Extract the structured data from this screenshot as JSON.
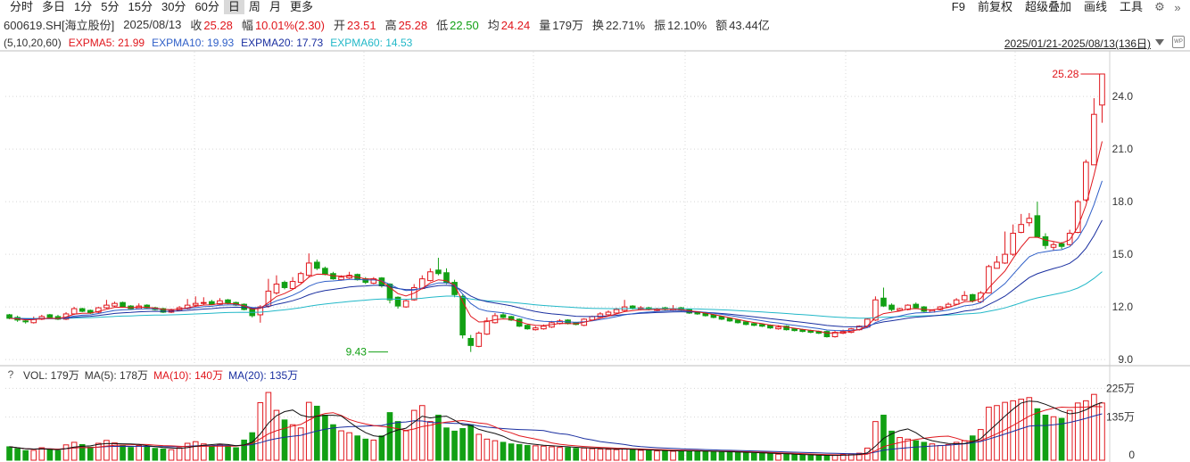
{
  "periods": [
    {
      "label": "分时",
      "active": false
    },
    {
      "label": "多日",
      "active": false
    },
    {
      "label": "1分",
      "active": false
    },
    {
      "label": "5分",
      "active": false
    },
    {
      "label": "15分",
      "active": false
    },
    {
      "label": "30分",
      "active": false
    },
    {
      "label": "60分",
      "active": false
    },
    {
      "label": "日",
      "active": true
    },
    {
      "label": "周",
      "active": false
    },
    {
      "label": "月",
      "active": false
    },
    {
      "label": "更多",
      "active": false
    }
  ],
  "tools": [
    "F9",
    "前复权",
    "超级叠加",
    "画线",
    "工具"
  ],
  "tool_icons": [
    "gear-icon",
    "double-chevron-right-icon"
  ],
  "quote": {
    "symbol": "600619.SH[海立股份]",
    "date": "2025/08/13",
    "fields": [
      {
        "key": "收",
        "value": "25.28",
        "tone": "red"
      },
      {
        "key": "幅",
        "value": "10.01%(2.30)",
        "tone": "red"
      },
      {
        "key": "开",
        "value": "23.51",
        "tone": "red"
      },
      {
        "key": "高",
        "value": "25.28",
        "tone": "red"
      },
      {
        "key": "低",
        "value": "22.50",
        "tone": "green"
      },
      {
        "key": "均",
        "value": "24.24",
        "tone": "red"
      },
      {
        "key": "量",
        "value": "179万",
        "tone": "plain"
      },
      {
        "key": "换",
        "value": "22.71%",
        "tone": "plain"
      },
      {
        "key": "振",
        "value": "12.10%",
        "tone": "plain"
      },
      {
        "key": "额",
        "value": "43.44亿",
        "tone": "plain"
      }
    ]
  },
  "ma_legend": [
    {
      "label": "(5,10,20,60)",
      "color": "#333333"
    },
    {
      "label": "EXPMA5: 21.99",
      "color": "#e0161c"
    },
    {
      "label": "EXPMA10: 19.93",
      "color": "#2f5fc8"
    },
    {
      "label": "EXPMA20: 17.73",
      "color": "#1a2fa0"
    },
    {
      "label": "EXPMA60: 14.53",
      "color": "#22b8c8"
    }
  ],
  "date_range": "2025/01/21-2025/08/13(136日)",
  "vol_legend": [
    {
      "label": "VOL: 179万",
      "color": "#333333"
    },
    {
      "label": "MA(5): 178万",
      "color": "#333333"
    },
    {
      "label": "MA(10): 140万",
      "color": "#e0161c"
    },
    {
      "label": "MA(20): 135万",
      "color": "#1a2fa0"
    }
  ],
  "chart_data": {
    "type": "candlestick",
    "x_range": [
      "2025/01/21",
      "2025/08/13"
    ],
    "count": 136,
    "price_axis": {
      "ticks": [
        9.0,
        12.0,
        15.0,
        18.0,
        21.0,
        24.0
      ],
      "ylim": [
        8.75,
        26.55
      ]
    },
    "volume_axis": {
      "ticks": [
        {
          "value": 0,
          "label": "0"
        },
        {
          "value": 135,
          "label": "135万"
        },
        {
          "value": 225,
          "label": "225万"
        }
      ],
      "ylim": [
        0,
        240
      ],
      "unit": "万"
    },
    "annotations": [
      {
        "label": "25.28",
        "value": 25.28,
        "kind": "high",
        "index": 135
      },
      {
        "label": "9.43",
        "value": 9.43,
        "kind": "low",
        "index": 47
      }
    ],
    "colors": {
      "up": "#e0161c",
      "down": "#12a014",
      "ema5": "#e0161c",
      "ema10": "#2f5fc8",
      "ema20": "#1a2fa0",
      "ema60": "#22b8c8",
      "vma5": "#111111",
      "vma10": "#e0161c",
      "vma20": "#1a2fa0"
    },
    "close": [
      11.35,
      11.25,
      11.15,
      11.3,
      11.45,
      11.4,
      11.3,
      11.6,
      11.9,
      11.75,
      11.65,
      11.95,
      12.1,
      12.2,
      12.0,
      11.9,
      12.05,
      11.95,
      11.85,
      11.7,
      11.8,
      11.95,
      12.1,
      12.2,
      12.25,
      12.15,
      12.35,
      12.2,
      12.1,
      11.85,
      11.5,
      12.0,
      12.9,
      13.3,
      13.1,
      13.45,
      13.9,
      14.5,
      14.2,
      13.85,
      13.6,
      13.7,
      13.8,
      13.55,
      13.4,
      13.6,
      13.2,
      12.4,
      12.05,
      12.35,
      13.1,
      13.6,
      14.0,
      13.9,
      13.4,
      12.7,
      10.4,
      9.8,
      10.5,
      11.2,
      11.5,
      11.4,
      11.25,
      10.9,
      10.75,
      10.8,
      10.9,
      11.1,
      11.2,
      11.05,
      11.0,
      11.3,
      11.45,
      11.6,
      11.7,
      11.85,
      12.0,
      11.9,
      11.95,
      11.85,
      11.9,
      11.85,
      11.9,
      11.8,
      11.65,
      11.6,
      11.5,
      11.4,
      11.3,
      11.2,
      11.1,
      11.0,
      10.95,
      10.9,
      10.8,
      10.85,
      10.7,
      10.65,
      10.6,
      10.55,
      10.5,
      10.3,
      10.55,
      10.6,
      10.75,
      10.9,
      11.3,
      12.4,
      12.05,
      11.85,
      11.9,
      12.1,
      11.95,
      11.75,
      11.8,
      12.0,
      12.15,
      12.4,
      12.65,
      12.35,
      12.8,
      14.3,
      14.55,
      15.0,
      16.2,
      16.7,
      17.05,
      16.0,
      15.5,
      15.55,
      15.45,
      16.2,
      18.0,
      20.25,
      22.98,
      25.28
    ],
    "open": [
      11.55,
      11.4,
      11.2,
      11.1,
      11.3,
      11.55,
      11.45,
      11.3,
      11.6,
      11.9,
      11.8,
      11.7,
      11.95,
      12.05,
      12.25,
      12.05,
      11.9,
      12.1,
      11.95,
      11.9,
      11.7,
      11.8,
      11.9,
      12.1,
      12.2,
      12.3,
      12.15,
      12.4,
      12.25,
      12.15,
      11.9,
      11.55,
      12.05,
      12.8,
      13.4,
      13.05,
      13.4,
      13.8,
      14.55,
      14.2,
      13.9,
      13.55,
      13.65,
      13.85,
      13.6,
      13.35,
      13.65,
      13.3,
      12.55,
      12.0,
      12.4,
      13.05,
      13.5,
      14.1,
      13.95,
      13.4,
      12.6,
      10.2,
      9.75,
      10.45,
      11.1,
      11.55,
      11.45,
      11.3,
      10.95,
      10.7,
      10.75,
      10.85,
      11.05,
      11.25,
      11.1,
      10.95,
      11.25,
      11.4,
      11.55,
      11.65,
      11.8,
      12.05,
      11.85,
      11.95,
      11.8,
      11.95,
      11.8,
      11.95,
      11.85,
      11.7,
      11.65,
      11.55,
      11.45,
      11.35,
      11.25,
      11.15,
      11.05,
      11.0,
      10.95,
      10.75,
      10.9,
      10.75,
      10.7,
      10.65,
      10.6,
      10.6,
      10.3,
      10.5,
      10.55,
      10.7,
      10.85,
      11.25,
      12.5,
      12.1,
      11.8,
      11.85,
      12.15,
      12.0,
      11.7,
      11.85,
      12.0,
      12.15,
      12.4,
      12.7,
      12.3,
      12.8,
      14.2,
      14.5,
      15.0,
      16.25,
      16.8,
      17.2,
      16.0,
      15.4,
      15.6,
      15.55,
      16.25,
      18.1,
      20.1,
      23.51
    ],
    "high": [
      11.6,
      11.5,
      11.3,
      11.45,
      11.55,
      11.6,
      11.55,
      11.7,
      12.0,
      11.95,
      11.85,
      12.0,
      12.4,
      12.3,
      12.3,
      12.1,
      12.2,
      12.15,
      12.0,
      11.95,
      11.9,
      12.05,
      12.45,
      12.6,
      12.55,
      12.4,
      12.5,
      12.45,
      12.3,
      12.2,
      11.95,
      12.1,
      13.6,
      13.8,
      13.5,
      13.7,
      14.0,
      15.05,
      14.7,
      14.3,
      14.0,
      13.8,
      14.0,
      13.9,
      13.7,
      13.7,
      13.7,
      13.35,
      12.6,
      12.45,
      13.3,
      13.8,
      14.2,
      14.8,
      14.2,
      13.55,
      12.7,
      10.4,
      10.6,
      11.4,
      11.65,
      11.7,
      11.5,
      11.35,
      11.0,
      10.9,
      11.0,
      11.2,
      11.3,
      11.3,
      11.15,
      11.35,
      11.5,
      11.7,
      11.8,
      11.95,
      12.4,
      12.1,
      12.05,
      12.0,
      11.95,
      12.0,
      12.1,
      12.0,
      11.9,
      11.75,
      11.7,
      11.6,
      11.5,
      11.4,
      11.3,
      11.2,
      11.1,
      11.05,
      11.0,
      10.95,
      10.95,
      10.8,
      10.75,
      10.7,
      10.65,
      10.65,
      10.65,
      10.7,
      10.8,
      10.95,
      11.35,
      12.6,
      13.1,
      12.2,
      11.95,
      12.15,
      12.25,
      12.05,
      11.85,
      12.05,
      12.25,
      12.5,
      12.9,
      12.75,
      12.9,
      14.4,
      14.9,
      16.3,
      16.7,
      17.3,
      17.35,
      18.0,
      16.2,
      15.7,
      15.7,
      16.4,
      18.1,
      20.4,
      23.9,
      25.28
    ],
    "low": [
      11.3,
      11.15,
      11.05,
      11.05,
      11.25,
      11.35,
      11.25,
      11.25,
      11.55,
      11.7,
      11.6,
      11.65,
      11.9,
      12.0,
      11.95,
      11.85,
      11.85,
      11.9,
      11.8,
      11.65,
      11.65,
      11.75,
      11.85,
      12.0,
      12.1,
      12.1,
      12.1,
      12.15,
      12.05,
      11.8,
      11.4,
      11.1,
      11.95,
      12.7,
      13.0,
      13.0,
      13.35,
      13.7,
      14.1,
      13.8,
      13.55,
      13.5,
      13.6,
      13.5,
      13.3,
      13.3,
      13.1,
      12.2,
      11.9,
      11.95,
      12.35,
      13.0,
      13.45,
      13.8,
      13.3,
      12.55,
      10.2,
      9.43,
      9.7,
      10.4,
      11.05,
      11.35,
      11.2,
      10.85,
      10.7,
      10.65,
      10.7,
      10.8,
      11.0,
      11.0,
      10.95,
      10.9,
      11.2,
      11.35,
      11.5,
      11.6,
      11.75,
      11.85,
      11.8,
      11.8,
      11.75,
      11.8,
      11.75,
      11.75,
      11.6,
      11.55,
      11.45,
      11.35,
      11.25,
      11.15,
      11.05,
      10.95,
      10.9,
      10.85,
      10.75,
      10.7,
      10.65,
      10.6,
      10.55,
      10.5,
      10.45,
      10.25,
      10.25,
      10.45,
      10.5,
      10.65,
      10.8,
      11.2,
      12.0,
      11.75,
      11.75,
      11.8,
      11.9,
      11.7,
      11.7,
      11.8,
      12.0,
      12.1,
      12.35,
      12.25,
      12.25,
      12.8,
      14.2,
      14.45,
      14.9,
      16.2,
      16.6,
      16.0,
      15.3,
      15.2,
      15.3,
      15.5,
      16.2,
      18.0,
      20.1,
      22.5
    ],
    "volume": [
      42,
      36,
      30,
      31,
      39,
      34,
      30,
      48,
      56,
      49,
      41,
      53,
      62,
      54,
      47,
      40,
      46,
      42,
      37,
      35,
      33,
      39,
      53,
      58,
      51,
      43,
      49,
      44,
      39,
      63,
      86,
      180,
      212,
      156,
      126,
      111,
      101,
      181,
      169,
      141,
      111,
      92,
      86,
      76,
      66,
      63,
      76,
      149,
      121,
      92,
      156,
      171,
      121,
      141,
      101,
      91,
      99,
      111,
      81,
      66,
      61,
      56,
      51,
      49,
      46,
      45,
      44,
      42,
      40,
      39,
      37,
      38,
      36,
      35,
      34,
      33,
      36,
      32,
      31,
      30,
      29,
      30,
      28,
      30,
      29,
      28,
      27,
      26,
      25,
      26,
      24,
      23,
      22,
      21,
      20,
      19,
      18,
      17,
      16,
      15,
      14,
      15,
      16,
      18,
      20,
      22,
      38,
      121,
      141,
      91,
      71,
      66,
      61,
      56,
      51,
      46,
      49,
      56,
      61,
      76,
      96,
      166,
      171,
      181,
      186,
      191,
      196,
      161,
      141,
      136,
      131,
      156,
      179,
      186,
      206,
      179
    ]
  }
}
